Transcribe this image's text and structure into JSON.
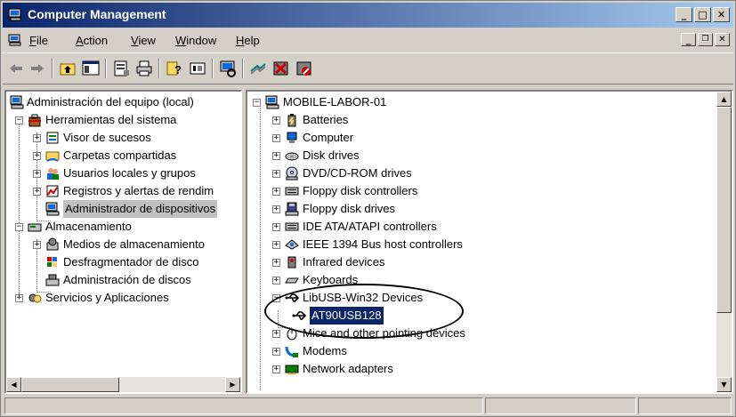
{
  "window": {
    "title": "Computer Management"
  },
  "menu": [
    {
      "label": "File",
      "accel": "F"
    },
    {
      "label": "Action",
      "accel": "A"
    },
    {
      "label": "View",
      "accel": "V"
    },
    {
      "label": "Window",
      "accel": "W"
    },
    {
      "label": "Help",
      "accel": "H"
    }
  ],
  "left_tree": {
    "root": "Administración del equipo (local)",
    "items": [
      "Herramientas del sistema",
      "Visor de sucesos",
      "Carpetas compartidas",
      "Usuarios locales y grupos",
      "Registros y alertas de rendim",
      "Administrador de dispositivos",
      "Almacenamiento",
      "Medios de almacenamiento",
      "Desfragmentador de disco",
      "Administración de discos",
      "Servicios y Aplicaciones"
    ],
    "selected": "Administrador de dispositivos"
  },
  "right_tree": {
    "root": "MOBILE-LABOR-01",
    "items": [
      "Batteries",
      "Computer",
      "Disk drives",
      "DVD/CD-ROM drives",
      "Floppy disk controllers",
      "Floppy disk drives",
      "IDE ATA/ATAPI controllers",
      "IEEE 1394 Bus host controllers",
      "Infrared devices",
      "Keyboards",
      "LibUSB-Win32 Devices",
      "AT90USB128",
      "Mice and other pointing devices",
      "Modems",
      "Network adapters"
    ],
    "selected": "AT90USB128"
  },
  "colors": {
    "title_start": "#0a246a",
    "title_end": "#a6caf0",
    "selection": "#0a246a",
    "face": "#d4d0c8"
  }
}
